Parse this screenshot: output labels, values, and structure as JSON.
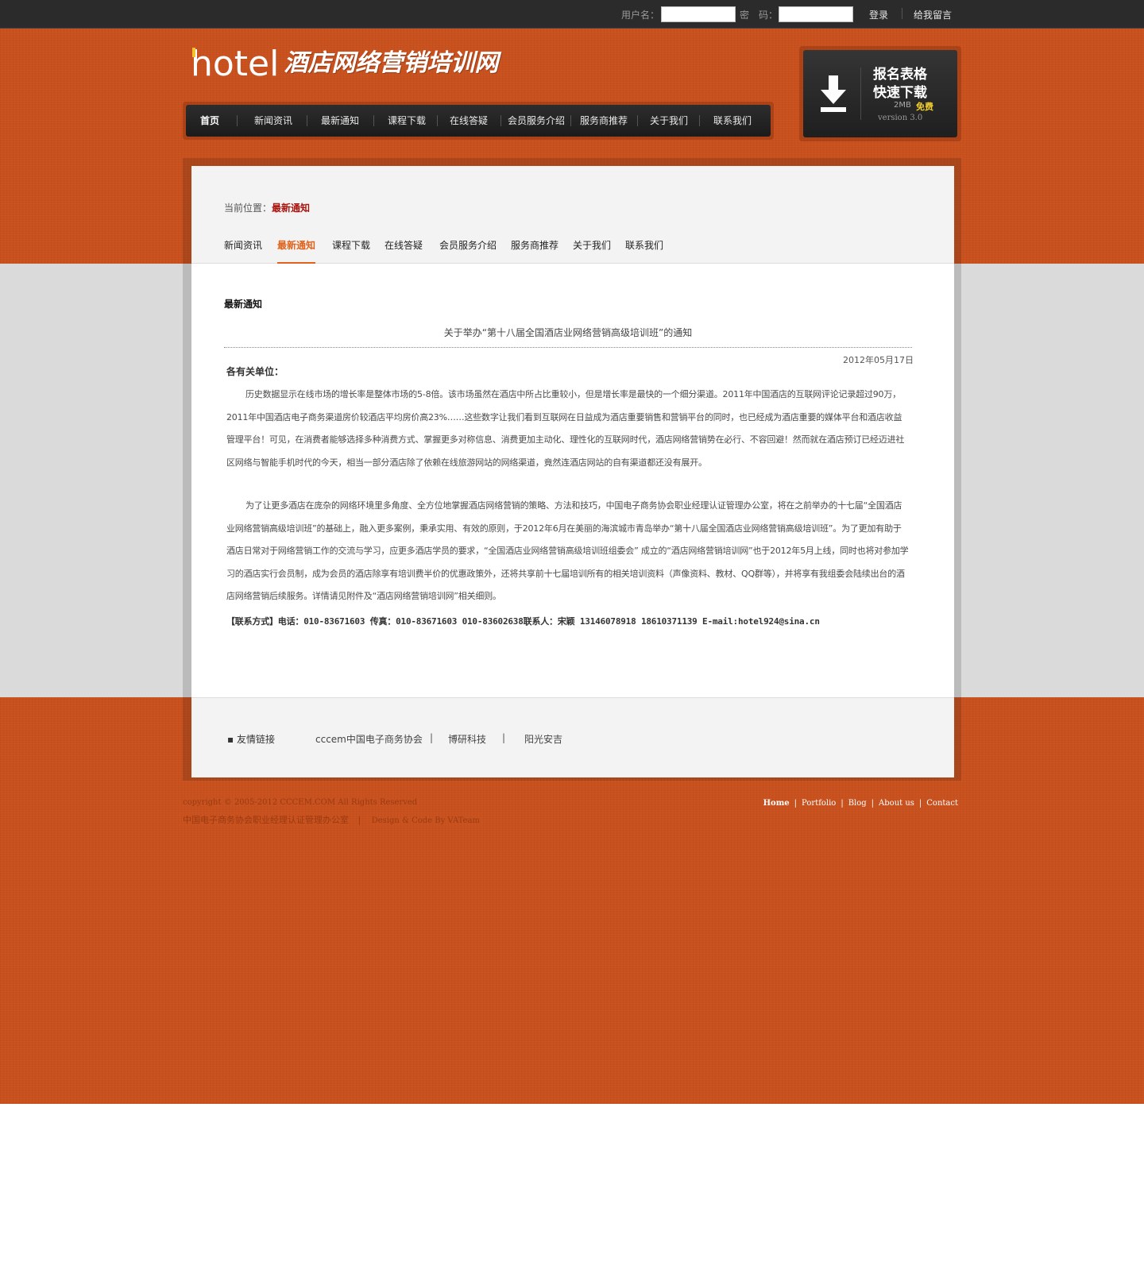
{
  "topbar": {
    "username_label": "用户名：",
    "username_value": "",
    "password_label": "密　码：",
    "password_value": "",
    "login_label": "登录",
    "message_label": "给我留言"
  },
  "logo": {
    "en": "hotel",
    "cn": "酒店网络营销培训网"
  },
  "main_nav": {
    "items": [
      "首页",
      "新闻资讯",
      "最新通知",
      "课程下载",
      "在线答疑",
      "会员服务介绍",
      "服务商推荐",
      "关于我们",
      "联系我们"
    ],
    "active": "首页"
  },
  "download_box": {
    "line1": "报名表格",
    "line2": "快速下载",
    "size": "2MB",
    "free": "免费",
    "version": "version 3.0",
    "icon": "download-arrow-icon"
  },
  "breadcrumb": {
    "label": "当前位置：",
    "current": "最新通知"
  },
  "sub_nav": {
    "items": [
      "新闻资讯",
      "最新通知",
      "课程下载",
      "在线答疑",
      "会员服务介绍",
      "服务商推荐",
      "关于我们",
      "联系我们"
    ],
    "active": "最新通知"
  },
  "article": {
    "section_title": "最新通知",
    "title": "关于举办“第十八届全国酒店业网络营销高级培训班”的通知",
    "date": "2012年05月17日",
    "greeting": "各有关单位：",
    "paragraphs": [
      "历史数据显示在线市场的增长率是整体市场的5-8倍。该市场虽然在酒店中所占比重较小，但是增长率是最快的一个细分渠道。2011年中国酒店的互联网评论记录超过90万，2011年中国酒店电子商务渠道房价较酒店平均房价高23%……这些数字让我们看到互联网在日益成为酒店重要销售和营销平台的同时，也已经成为酒店重要的媒体平台和酒店收益管理平台！可见，在消费者能够选择多种消费方式、掌握更多对称信息、消费更加主动化、理性化的互联网时代，酒店网络营销势在必行、不容回避！然而就在酒店预订已经迈进社区网络与智能手机时代的今天，相当一部分酒店除了依赖在线旅游网站的网络渠道，竟然连酒店网站的自有渠道都还没有展开。",
      "为了让更多酒店在庞杂的网络环境里多角度、全方位地掌握酒店网络营销的策略、方法和技巧，中国电子商务协会职业经理认证管理办公室，将在之前举办的十七届“全国酒店业网络营销高级培训班”的基础上，融入更多案例，秉承实用、有效的原则，于2012年6月在美丽的海滨城市青岛举办“第十八届全国酒店业网络营销高级培训班”。为了更加有助于酒店日常对于网络营销工作的交流与学习，应更多酒店学员的要求，“全国酒店业网络营销高级培训班组委会”  成立的“酒店网络营销培训网”也于2012年5月上线，同时也将对参加学习的酒店实行会员制，成为会员的酒店除享有培训费半价的优惠政策外，还将共享前十七届培训所有的相关培训资料（声像资料、教材、QQ群等），并将享有我组委会陆续出台的酒店网络营销后续服务。详情请见附件及“酒店网络营销培训网”相关细则。"
    ],
    "contact": "【联系方式】电话：010-83671603 传真：010-83671603 010-83602638联系人：宋颖 13146078918 18610371139  E-mail:hotel924@sina.cn"
  },
  "friend_links": {
    "label": "友情链接",
    "links": [
      "cccem中国电子商务协会",
      "博研科技",
      "阳光安吉"
    ],
    "separator": "|"
  },
  "footer": {
    "copyright": "copyright © 2005-2012 CCCEM.COM All Rights Reserved",
    "org": "中国电子商务协会职业经理认证管理办公室",
    "pipe": "|",
    "design": "Design & Code By VATeam",
    "links": [
      "Home",
      "Portfolio",
      "Blog",
      "About us",
      "Contact"
    ]
  },
  "colors": {
    "brand_orange": "#c9511e",
    "active_accent": "#e0621b",
    "crumb_red": "#a8130d",
    "topbar_bg": "#2b2b2b",
    "free_yellow": "#f4d02a"
  }
}
